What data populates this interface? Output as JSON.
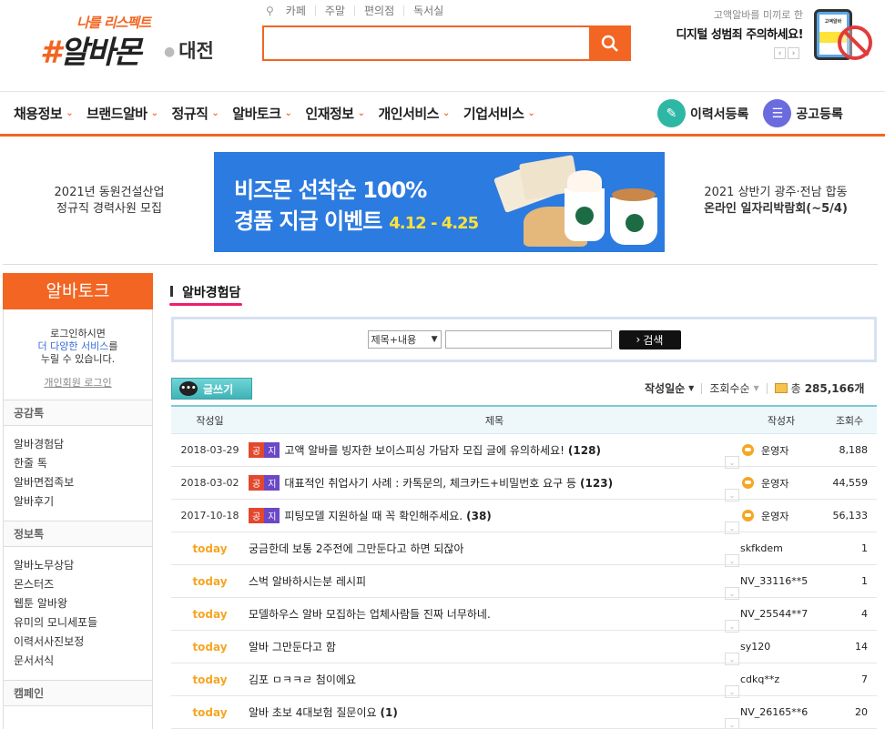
{
  "header": {
    "logo_tag": "나를 리스펙트",
    "logo_main": "알바몬",
    "region": "대전",
    "search_links": [
      "카페",
      "주말",
      "편의점",
      "독서실"
    ],
    "search_placeholder": "",
    "ad_line1": "고액알바를 미끼로 한",
    "ad_line2": "디지털 성범죄 주의하세요!",
    "ad_phone_text": "고액알바"
  },
  "nav": {
    "items": [
      "채용정보",
      "브랜드알바",
      "정규직",
      "알바토크",
      "인재정보",
      "개인서비스",
      "기업서비스"
    ],
    "resume_label": "이력서등록",
    "post_label": "공고등록"
  },
  "banners": {
    "left_line1": "2021년 동원건설산업",
    "left_line2": "정규직 경력사원 모집",
    "center_line1": "비즈몬 선착순 100%",
    "center_line2": "경품 지급 이벤트",
    "center_date": "4.12 - 4.25",
    "right_line1": "2021 상반기 광주·전남 합동",
    "right_line2": "온라인 일자리박람회(~5/4)"
  },
  "sidebar": {
    "title": "알바토크",
    "login_text1": "로그인하시면",
    "login_text2_blue": "더 다양한 서비스",
    "login_text2_rest": "를",
    "login_text3": "누릴 수 있습니다.",
    "login_link": "개인회원 로그인",
    "sections": [
      {
        "title": "공감톡",
        "items": [
          "알바경험담",
          "한줄 톡",
          "알바면접족보",
          "알바후기"
        ]
      },
      {
        "title": "정보톡",
        "items": [
          "알바노무상담",
          "몬스터즈",
          "웹툰 알바왕",
          "유미의 모니세포들",
          "이력서사진보정",
          "문서서식"
        ]
      },
      {
        "title": "캠페인",
        "items": []
      }
    ]
  },
  "main": {
    "title": "알바경험담",
    "search_select": "제목+내용",
    "search_value": "",
    "search_button": "검색",
    "write_button": "글쓰기",
    "sort_by_date": "작성일순",
    "sort_by_views": "조회수순",
    "total_label": "총",
    "total_count": "285,166개",
    "columns": [
      "작성일",
      "제목",
      "작성자",
      "조회수"
    ],
    "notice_tag": [
      "공",
      "지"
    ],
    "rows": [
      {
        "date": "2018-03-29",
        "notice": true,
        "title": "고액 알바를 빙자한 보이스피싱 가담자 모집 글에 유의하세요!",
        "comments": "(128)",
        "author": "운영자",
        "views": "8,188"
      },
      {
        "date": "2018-03-02",
        "notice": true,
        "title": "대표적인 취업사기 사례 : 카톡문의, 체크카드+비밀번호 요구 등",
        "comments": "(123)",
        "author": "운영자",
        "views": "44,559"
      },
      {
        "date": "2017-10-18",
        "notice": true,
        "title": "피팅모델 지원하실 때 꼭 확인해주세요.",
        "comments": "(38)",
        "author": "운영자",
        "views": "56,133"
      },
      {
        "date": "today",
        "notice": false,
        "title": "궁금한데 보통 2주전에 그만둔다고 하면 되잖아",
        "comments": "",
        "author": "skfkdem",
        "views": "1"
      },
      {
        "date": "today",
        "notice": false,
        "title": "스벅 알바하시는분 레시피",
        "comments": "",
        "author": "NV_33116**5",
        "views": "1"
      },
      {
        "date": "today",
        "notice": false,
        "title": "모델하우스 알바 모집하는 업체사람들 진짜 너무하네.",
        "comments": "",
        "author": "NV_25544**7",
        "views": "4"
      },
      {
        "date": "today",
        "notice": false,
        "title": "알바 그만둔다고 함",
        "comments": "",
        "author": "sy120",
        "views": "14"
      },
      {
        "date": "today",
        "notice": false,
        "title": "김포 ㅁㅋㅋㄹ 첨이에요",
        "comments": "",
        "author": "cdkq**z",
        "views": "7"
      },
      {
        "date": "today",
        "notice": false,
        "title": "알바 초보 4대보험 질문이요",
        "comments": "(1)",
        "author": "NV_26165**6",
        "views": "20"
      }
    ]
  },
  "colors": {
    "accent": "#f26522",
    "teal": "#3fb3b8",
    "pink": "#f21e6a",
    "today": "#f5a623"
  }
}
